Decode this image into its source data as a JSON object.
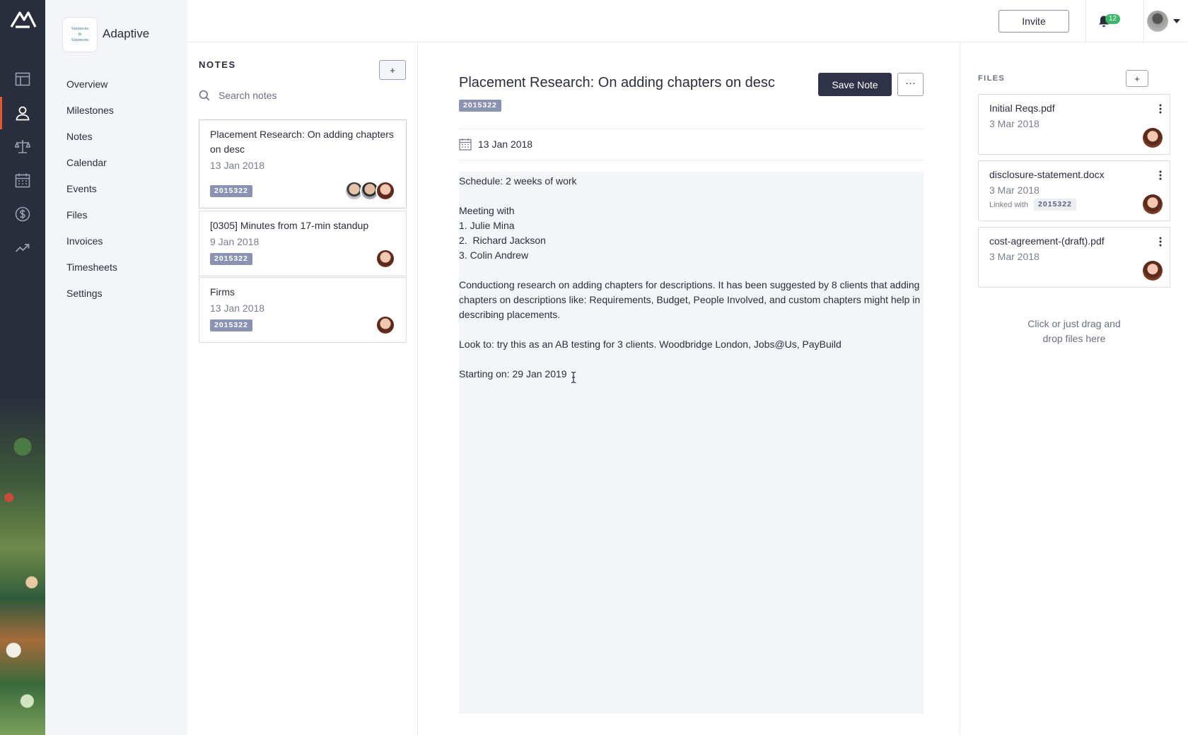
{
  "app": {
    "name": "Adaptive"
  },
  "project": {
    "name": "Adaptive",
    "logo_text": [
      "Simmons",
      "&",
      "Simmons"
    ]
  },
  "nav": {
    "items": [
      {
        "label": "Overview"
      },
      {
        "label": "Milestones"
      },
      {
        "label": "Notes"
      },
      {
        "label": "Calendar"
      },
      {
        "label": "Events"
      },
      {
        "label": "Files"
      },
      {
        "label": "Invoices"
      },
      {
        "label": "Timesheets"
      },
      {
        "label": "Settings"
      }
    ]
  },
  "rail": {
    "icons": [
      "dashboard-icon",
      "person-icon",
      "scales-icon",
      "calendar-icon",
      "dollar-icon",
      "trending-up-icon"
    ],
    "active": "person-icon",
    "accent": "#e4572e"
  },
  "topbar": {
    "invite_label": "Invite",
    "notification_count": "12"
  },
  "notes_panel": {
    "title": "NOTES",
    "add_label": "+",
    "search_placeholder": "Search notes",
    "notes": [
      {
        "title": "Placement Research: On adding chapters on desc",
        "date": "13 Jan 2018",
        "tag": "2015322",
        "avatars": [
          "man",
          "man",
          "woman"
        ]
      },
      {
        "title": "[0305] Minutes from 17-min standup",
        "date": "9 Jan 2018",
        "tag": "2015322",
        "avatars": [
          "woman"
        ]
      },
      {
        "title": "Firms",
        "date": "13 Jan 2018",
        "tag": "2015322",
        "avatars": [
          "woman"
        ]
      }
    ]
  },
  "editor": {
    "title": "Placement Research: On adding chapters on desc",
    "tag": "2015322",
    "save_label": "Save Note",
    "more_label": "···",
    "date": "13 Jan 2018",
    "body": [
      "Schedule: 2 weeks of work",
      "",
      "Meeting with",
      "1. Julie Mina",
      "2.  Richard Jackson",
      "3. Colin Andrew",
      "",
      "Conductiong research on adding chapters for descriptions. It has been suggested by 8 clients that adding chapters on descriptions like: Requirements, Budget, People Involved, and custom chapters might help in describing placements.",
      "",
      "Look to: try this as an AB testing for 3 clients. Woodbridge London, Jobs@Us, PayBuild",
      "",
      "Starting on: 29 Jan 2019"
    ]
  },
  "files_panel": {
    "title": "FILES",
    "add_label": "+",
    "files": [
      {
        "name": "Initial Reqs.pdf",
        "date": "3 Mar 2018"
      },
      {
        "name": "disclosure-statement.docx",
        "date": "3 Mar 2018",
        "linked_label": "Linked with",
        "linked_tag": "2015322"
      },
      {
        "name": "cost-agreement-(draft).pdf",
        "date": "3 Mar 2018"
      }
    ],
    "drop_hint_line1": "Click or just drag and",
    "drop_hint_line2": "drop files here"
  }
}
